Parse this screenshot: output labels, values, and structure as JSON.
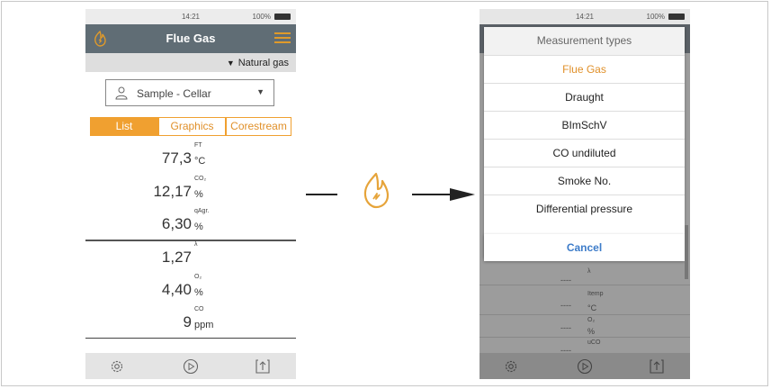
{
  "left": {
    "status": {
      "time": "14:21",
      "battery": "100%"
    },
    "title": "Flue Gas",
    "fuel": "Natural gas",
    "sample": "Sample - Cellar",
    "tabs": [
      "List",
      "Graphics",
      "Corestream"
    ],
    "readings": [
      {
        "value": "77,3",
        "label": "FT",
        "unit": "°C"
      },
      {
        "value": "12,17",
        "label": "CO₂",
        "unit": "%"
      },
      {
        "value": "6,30",
        "label": "qAgr.",
        "unit": "%"
      },
      {
        "value": "1,27",
        "label": "λ",
        "unit": ""
      },
      {
        "value": "4,40",
        "label": "O₂",
        "unit": "%"
      },
      {
        "value": "9",
        "label": "CO",
        "unit": "ppm"
      }
    ]
  },
  "right": {
    "status": {
      "time": "14:21",
      "battery": "100%"
    },
    "dialog_title": "Measurement types",
    "options": [
      "Flue Gas",
      "Draught",
      "BImSchV",
      "CO undiluted",
      "Smoke No.",
      "Differential pressure"
    ],
    "selected_option": "Flue Gas",
    "cancel": "Cancel",
    "background_rows": [
      {
        "dash": "----",
        "label": "λ",
        "unit": ""
      },
      {
        "dash": "----",
        "label": "Itemp",
        "unit": "°C"
      },
      {
        "dash": "----",
        "label": "O₂",
        "unit": "%"
      },
      {
        "dash": "----",
        "label": "uCO",
        "unit": ""
      }
    ]
  },
  "colors": {
    "accent": "#f0a030",
    "titlebar": "#606d75",
    "cancel": "#3d7cc9"
  },
  "icons": [
    "flame-icon",
    "menu-icon",
    "person-icon",
    "settings-icon",
    "play-icon",
    "export-icon"
  ]
}
